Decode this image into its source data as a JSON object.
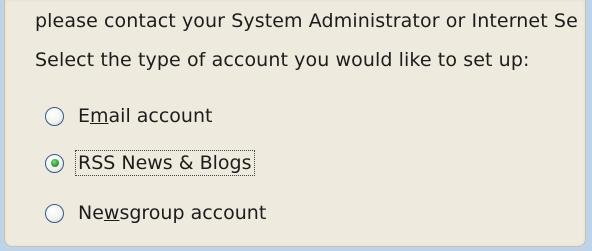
{
  "dialog": {
    "info_text": "please contact your System Administrator or Internet Se",
    "prompt": "Select the type of account you would like to set up:"
  },
  "account_types": {
    "selected": "RSS News & Blogs",
    "options": [
      {
        "pre": "E",
        "key": "m",
        "post": "ail account",
        "checked": false
      },
      {
        "pre": "",
        "key": "",
        "post": "RSS News & Blogs",
        "checked": true
      },
      {
        "pre": "Ne",
        "key": "w",
        "post": "sgroup account",
        "checked": false
      }
    ]
  }
}
